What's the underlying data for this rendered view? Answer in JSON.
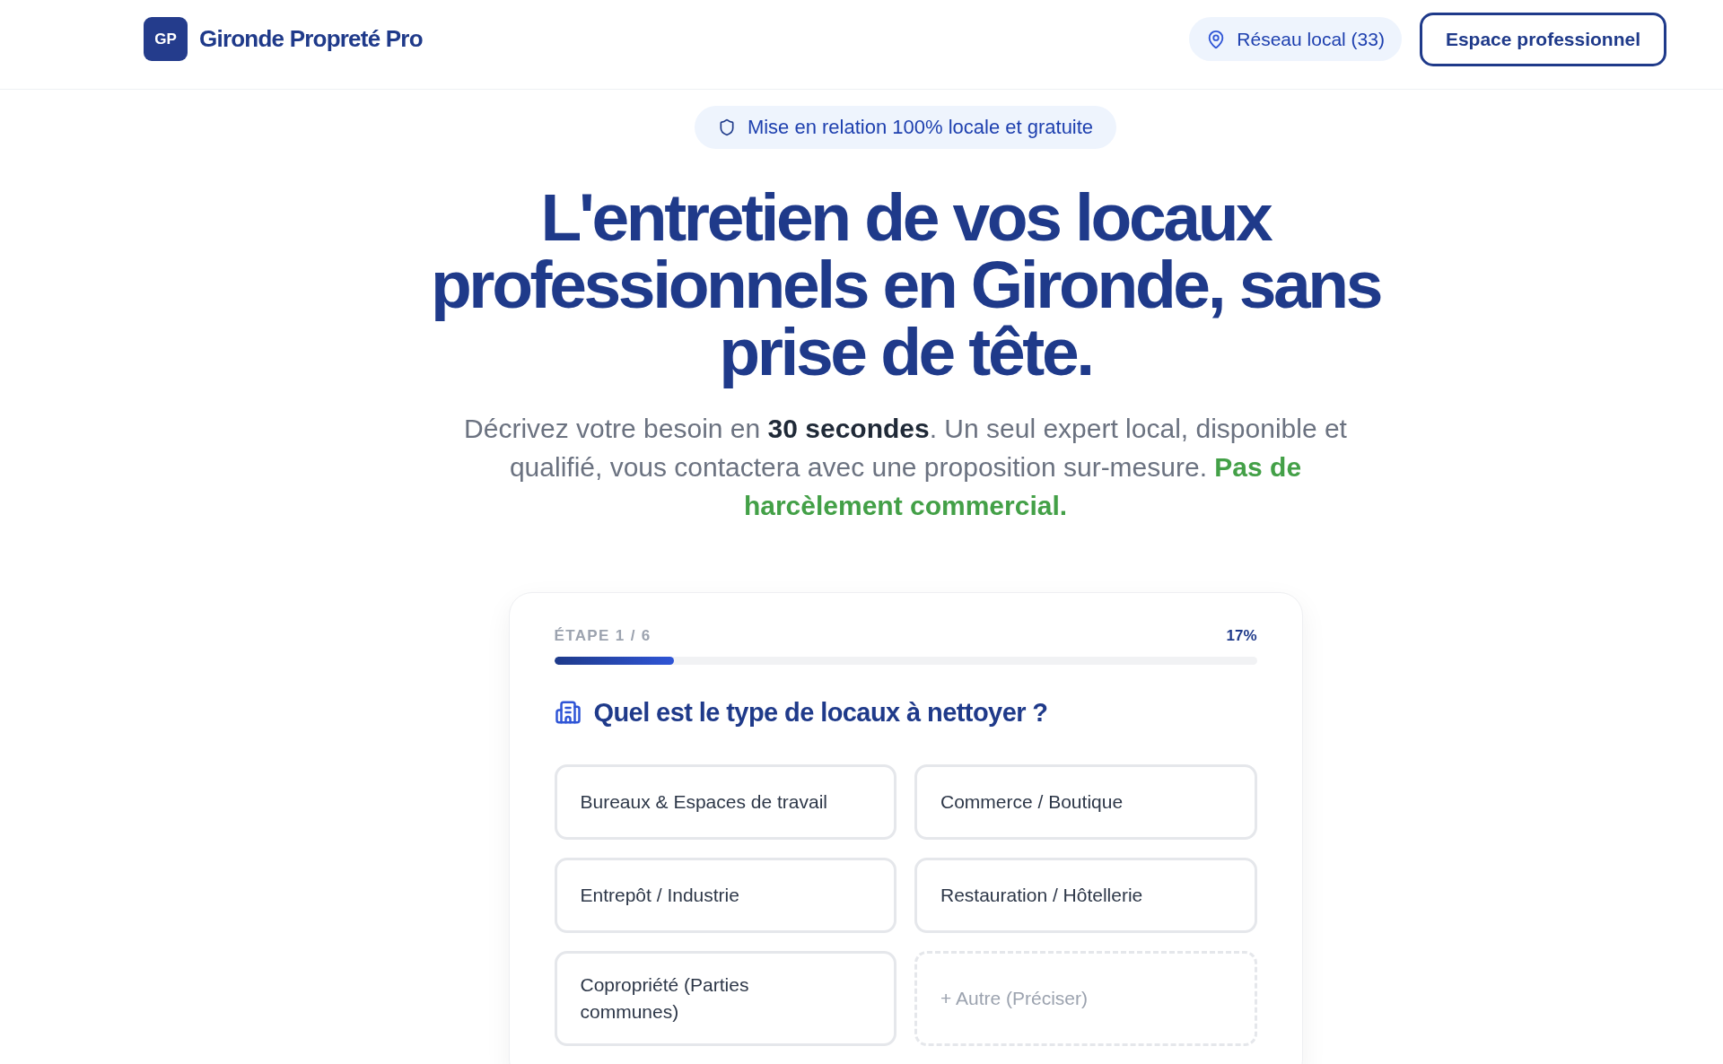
{
  "header": {
    "logo_mark": "GP",
    "brand": "Gironde Propreté Pro",
    "network_badge": "Réseau local (33)",
    "pro_button": "Espace professionnel"
  },
  "hero": {
    "badge": "Mise en relation 100% locale et gratuite",
    "title": "L'entretien de vos locaux professionnels en Gironde, sans prise de tête.",
    "subtitle": "Décrivez votre besoin en **30 secondes**. Un seul expert local, disponible et qualifié, vous contactera avec une proposition sur-mesure.",
    "subtitle_highlight": "Pas de harcèlement commercial."
  },
  "form": {
    "step_label": "ÉTAPE 1 / 6",
    "percent": "17%",
    "progress": {
      "level": 0.17
    },
    "question": "Quel est le type de locaux à nettoyer ?",
    "options": [
      {
        "label": "Bureaux & Espaces de travail",
        "kind": "choice",
        "selected": false
      },
      {
        "label": "Commerce / Boutique",
        "kind": "choice",
        "selected": false
      },
      {
        "label": "Entrepôt / Industrie",
        "kind": "choice",
        "selected": false
      },
      {
        "label": "Restauration / Hôtellerie",
        "kind": "choice",
        "selected": false
      },
      {
        "label": "Copropriété (Parties communes)",
        "kind": "choice",
        "selected": false
      },
      {
        "label": "+ Autre (Préciser)",
        "kind": "other",
        "selected": false
      }
    ]
  }
}
